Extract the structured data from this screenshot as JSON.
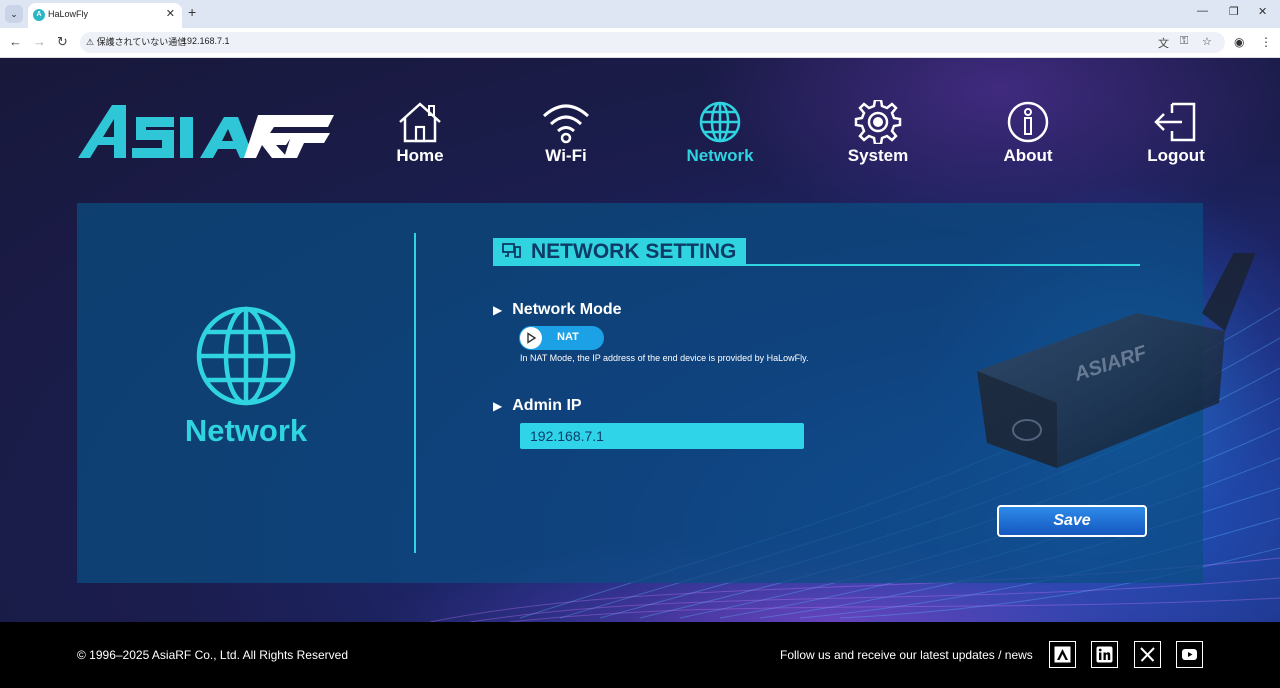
{
  "browser": {
    "tab_title": "HaLowFly",
    "security_label": "保護されていない通信",
    "url": "192.168.7.1"
  },
  "nav": {
    "items": [
      {
        "label": "Home",
        "icon": "home-icon"
      },
      {
        "label": "Wi-Fi",
        "icon": "wifi-icon"
      },
      {
        "label": "Network",
        "icon": "globe-icon",
        "active": true
      },
      {
        "label": "System",
        "icon": "gear-icon"
      },
      {
        "label": "About",
        "icon": "info-icon"
      },
      {
        "label": "Logout",
        "icon": "logout-icon"
      }
    ]
  },
  "panel": {
    "left_title": "Network",
    "section_title": "NETWORK SETTING",
    "network_mode": {
      "label": "Network Mode",
      "value": "NAT",
      "hint": "In NAT Mode, the IP address of the end device is provided by HaLowFly."
    },
    "admin_ip": {
      "label": "Admin IP",
      "value": "192.168.7.1"
    },
    "save_label": "Save"
  },
  "footer": {
    "copyright": "© 1996–2025 AsiaRF Co., Ltd. All Rights Reserved",
    "follow": "Follow us and receive our latest updates / news"
  },
  "colors": {
    "accent": "#2fd4e0",
    "panel": "#0a4e82",
    "toggle": "#1da1e6",
    "button": "#1f6fd6"
  }
}
